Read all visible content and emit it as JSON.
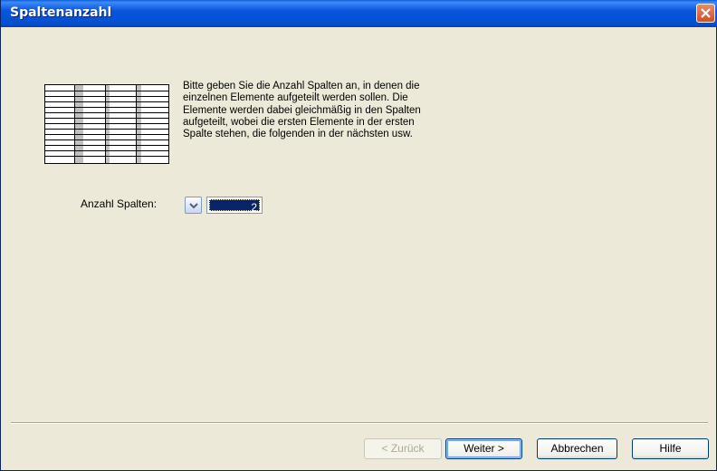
{
  "window": {
    "title": "Spaltenanzahl"
  },
  "icons": {
    "close": "close-icon",
    "chevron": "chevron-down-icon"
  },
  "content": {
    "description": "Bitte geben Sie die Anzahl Spalten an, in denen die\neinzelnen Elemente aufgeteilt werden sollen. Die\nElemente werden dabei gleichmäßig in den Spalten\naufgeteilt, wobei die ersten Elemente in der ersten\nSpalte stehen, die folgenden in der nächsten usw.",
    "columns_label": "Anzahl Spalten:",
    "columns_value": "2"
  },
  "buttons": {
    "back": "< Zurück",
    "next": "Weiter >",
    "cancel": "Abbrechen",
    "help": "Hilfe"
  },
  "colors": {
    "titlebar": "#0855dd",
    "dialog_bg": "#ece9d8",
    "selection": "#0a246a"
  }
}
